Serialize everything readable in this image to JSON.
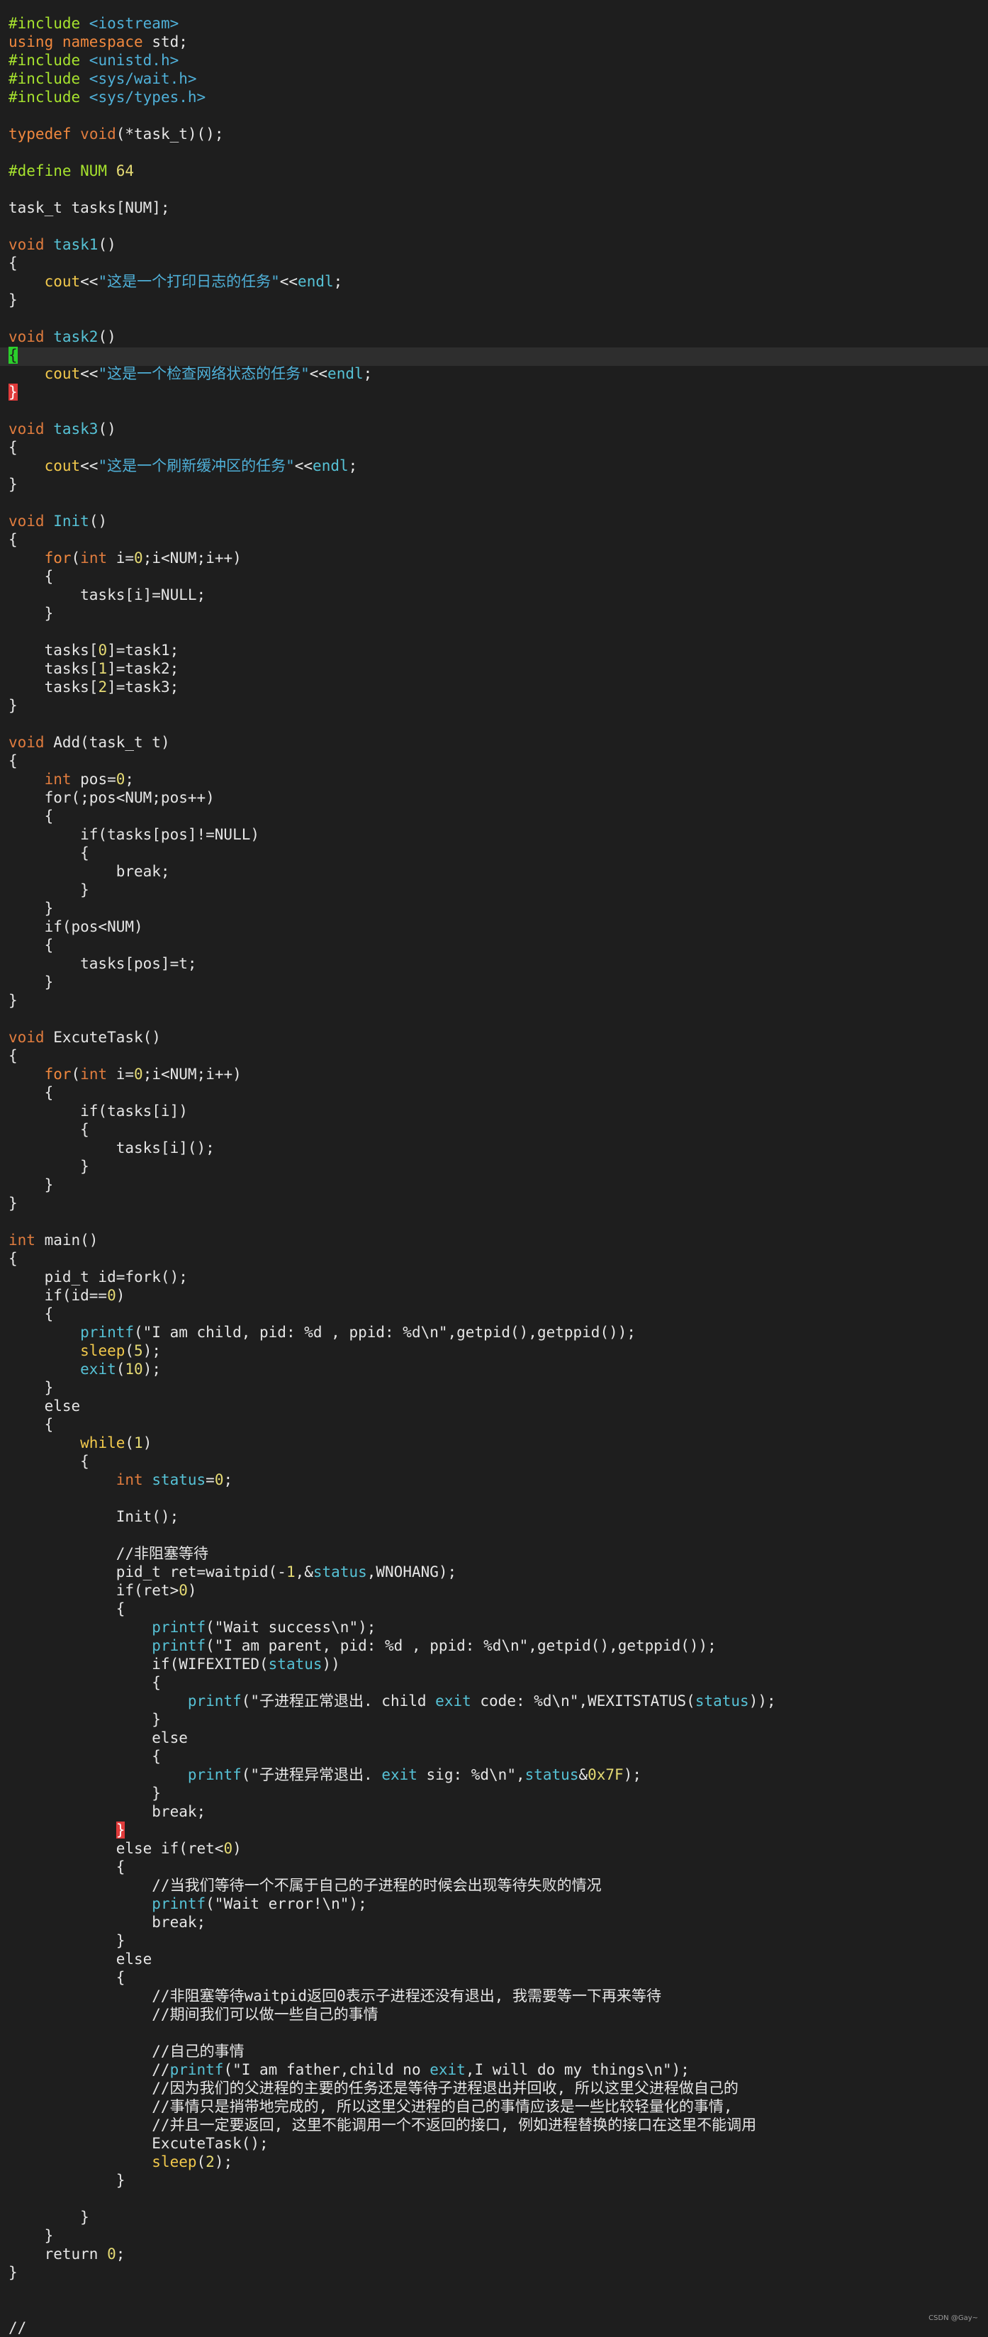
{
  "editor": {
    "watermark": "CSDN @Gay~",
    "lines": [
      [
        {
          "t": "#include ",
          "c": "pp"
        },
        {
          "t": "<iostream>",
          "c": "str"
        }
      ],
      [
        {
          "t": "using",
          "c": "kw"
        },
        {
          "t": " ",
          "c": "pl"
        },
        {
          "t": "namespace",
          "c": "kw"
        },
        {
          "t": " std;",
          "c": "pl"
        }
      ],
      [
        {
          "t": "#include ",
          "c": "pp"
        },
        {
          "t": "<unistd.h>",
          "c": "str"
        }
      ],
      [
        {
          "t": "#include ",
          "c": "pp"
        },
        {
          "t": "<sys/wait.h>",
          "c": "str"
        }
      ],
      [
        {
          "t": "#include ",
          "c": "pp"
        },
        {
          "t": "<sys/types.h>",
          "c": "str"
        }
      ],
      [],
      [
        {
          "t": "typedef",
          "c": "kw"
        },
        {
          "t": " ",
          "c": "pl"
        },
        {
          "t": "void",
          "c": "ty"
        },
        {
          "t": "(*task_t)();",
          "c": "pl"
        }
      ],
      [],
      [
        {
          "t": "#define NUM ",
          "c": "pp"
        },
        {
          "t": "64",
          "c": "num"
        }
      ],
      [],
      [
        {
          "t": "task_t tasks[NUM];",
          "c": "pl"
        }
      ],
      [],
      [
        {
          "t": "void",
          "c": "ty"
        },
        {
          "t": " ",
          "c": "pl"
        },
        {
          "t": "task1",
          "c": "ent"
        },
        {
          "t": "()",
          "c": "pl"
        }
      ],
      [
        {
          "t": "{",
          "c": "pl"
        }
      ],
      [
        {
          "t": "    ",
          "c": "pl"
        },
        {
          "t": "cout",
          "c": "fn"
        },
        {
          "t": "<<",
          "c": "pl"
        },
        {
          "t": "\"这是一个打印日志的任务\"",
          "c": "str"
        },
        {
          "t": "<<",
          "c": "pl"
        },
        {
          "t": "endl",
          "c": "ent"
        },
        {
          "t": ";",
          "c": "pl"
        }
      ],
      [
        {
          "t": "}",
          "c": "pl"
        }
      ],
      [],
      [
        {
          "t": "void",
          "c": "ty"
        },
        {
          "t": " ",
          "c": "pl"
        },
        {
          "t": "task2",
          "c": "ent"
        },
        {
          "t": "()",
          "c": "pl"
        }
      ],
      [
        {
          "t": "{",
          "c": "cur-green"
        }
      ],
      [
        {
          "t": "    ",
          "c": "pl"
        },
        {
          "t": "cout",
          "c": "fn"
        },
        {
          "t": "<<",
          "c": "pl"
        },
        {
          "t": "\"这是一个检查网络状态的任务\"",
          "c": "str"
        },
        {
          "t": "<<",
          "c": "pl"
        },
        {
          "t": "endl",
          "c": "ent"
        },
        {
          "t": ";",
          "c": "pl"
        }
      ],
      [
        {
          "t": "}",
          "c": "cur-red"
        }
      ],
      [],
      [
        {
          "t": "void",
          "c": "ty"
        },
        {
          "t": " ",
          "c": "pl"
        },
        {
          "t": "task3",
          "c": "ent"
        },
        {
          "t": "()",
          "c": "pl"
        }
      ],
      [
        {
          "t": "{",
          "c": "pl"
        }
      ],
      [
        {
          "t": "    ",
          "c": "pl"
        },
        {
          "t": "cout",
          "c": "fn"
        },
        {
          "t": "<<",
          "c": "pl"
        },
        {
          "t": "\"这是一个刷新缓冲区的任务\"",
          "c": "str"
        },
        {
          "t": "<<",
          "c": "pl"
        },
        {
          "t": "endl",
          "c": "ent"
        },
        {
          "t": ";",
          "c": "pl"
        }
      ],
      [
        {
          "t": "}",
          "c": "pl"
        }
      ],
      [],
      [
        {
          "t": "void",
          "c": "ty"
        },
        {
          "t": " ",
          "c": "pl"
        },
        {
          "t": "Init",
          "c": "ent"
        },
        {
          "t": "()",
          "c": "pl"
        }
      ],
      [
        {
          "t": "{",
          "c": "pl"
        }
      ],
      [
        {
          "t": "    ",
          "c": "pl"
        },
        {
          "t": "for",
          "c": "kw"
        },
        {
          "t": "(",
          "c": "pl"
        },
        {
          "t": "int",
          "c": "ty"
        },
        {
          "t": " i=",
          "c": "pl"
        },
        {
          "t": "0",
          "c": "num"
        },
        {
          "t": ";i<NUM;i++)",
          "c": "pl"
        }
      ],
      [
        {
          "t": "    {",
          "c": "pl"
        }
      ],
      [
        {
          "t": "        tasks[i]=NULL;",
          "c": "pl"
        }
      ],
      [
        {
          "t": "    }",
          "c": "pl"
        }
      ],
      [],
      [
        {
          "t": "    tasks[",
          "c": "pl"
        },
        {
          "t": "0",
          "c": "num"
        },
        {
          "t": "]=task1;",
          "c": "pl"
        }
      ],
      [
        {
          "t": "    tasks[",
          "c": "pl"
        },
        {
          "t": "1",
          "c": "num"
        },
        {
          "t": "]=task2;",
          "c": "pl"
        }
      ],
      [
        {
          "t": "    tasks[",
          "c": "pl"
        },
        {
          "t": "2",
          "c": "num"
        },
        {
          "t": "]=task3;",
          "c": "pl"
        }
      ],
      [
        {
          "t": "}",
          "c": "pl"
        }
      ],
      [],
      [
        {
          "t": "void",
          "c": "ty"
        },
        {
          "t": " Add(task_t t)",
          "c": "pl"
        }
      ],
      [
        {
          "t": "{",
          "c": "pl"
        }
      ],
      [
        {
          "t": "    ",
          "c": "pl"
        },
        {
          "t": "int",
          "c": "ty"
        },
        {
          "t": " pos=",
          "c": "pl"
        },
        {
          "t": "0",
          "c": "num"
        },
        {
          "t": ";",
          "c": "pl"
        }
      ],
      [
        {
          "t": "    for(;pos<NUM;pos++)",
          "c": "pl"
        }
      ],
      [
        {
          "t": "    {",
          "c": "pl"
        }
      ],
      [
        {
          "t": "        if(tasks[pos]!=NULL)",
          "c": "pl"
        }
      ],
      [
        {
          "t": "        {",
          "c": "pl"
        }
      ],
      [
        {
          "t": "            break;",
          "c": "pl"
        }
      ],
      [
        {
          "t": "        }",
          "c": "pl"
        }
      ],
      [
        {
          "t": "    }",
          "c": "pl"
        }
      ],
      [
        {
          "t": "    if(pos<NUM)",
          "c": "pl"
        }
      ],
      [
        {
          "t": "    {",
          "c": "pl"
        }
      ],
      [
        {
          "t": "        tasks[pos]=t;",
          "c": "pl"
        }
      ],
      [
        {
          "t": "    }",
          "c": "pl"
        }
      ],
      [
        {
          "t": "}",
          "c": "pl"
        }
      ],
      [],
      [
        {
          "t": "void",
          "c": "ty"
        },
        {
          "t": " ExcuteTask()",
          "c": "pl"
        }
      ],
      [
        {
          "t": "{",
          "c": "pl"
        }
      ],
      [
        {
          "t": "    ",
          "c": "pl"
        },
        {
          "t": "for",
          "c": "kw"
        },
        {
          "t": "(",
          "c": "pl"
        },
        {
          "t": "int",
          "c": "ty"
        },
        {
          "t": " i=",
          "c": "pl"
        },
        {
          "t": "0",
          "c": "num"
        },
        {
          "t": ";i<NUM;i++)",
          "c": "pl"
        }
      ],
      [
        {
          "t": "    {",
          "c": "pl"
        }
      ],
      [
        {
          "t": "        if(tasks[i])",
          "c": "pl"
        }
      ],
      [
        {
          "t": "        {",
          "c": "pl"
        }
      ],
      [
        {
          "t": "            tasks[i]();",
          "c": "pl"
        }
      ],
      [
        {
          "t": "        }",
          "c": "pl"
        }
      ],
      [
        {
          "t": "    }",
          "c": "pl"
        }
      ],
      [
        {
          "t": "}",
          "c": "pl"
        }
      ],
      [],
      [
        {
          "t": "int",
          "c": "ty"
        },
        {
          "t": " main()",
          "c": "pl"
        }
      ],
      [
        {
          "t": "{",
          "c": "pl"
        }
      ],
      [
        {
          "t": "    pid_t id=fork();",
          "c": "pl"
        }
      ],
      [
        {
          "t": "    if(id==",
          "c": "pl"
        },
        {
          "t": "0",
          "c": "num"
        },
        {
          "t": ")",
          "c": "pl"
        }
      ],
      [
        {
          "t": "    {",
          "c": "pl"
        }
      ],
      [
        {
          "t": "        ",
          "c": "pl"
        },
        {
          "t": "printf",
          "c": "ent"
        },
        {
          "t": "(\"I am child, pid: %d , ppid: %d\\n\",getpid(),getppid());",
          "c": "pl"
        }
      ],
      [
        {
          "t": "        ",
          "c": "pl"
        },
        {
          "t": "sleep",
          "c": "fn"
        },
        {
          "t": "(",
          "c": "pl"
        },
        {
          "t": "5",
          "c": "num"
        },
        {
          "t": ");",
          "c": "pl"
        }
      ],
      [
        {
          "t": "        ",
          "c": "pl"
        },
        {
          "t": "exit",
          "c": "ent"
        },
        {
          "t": "(",
          "c": "pl"
        },
        {
          "t": "10",
          "c": "num"
        },
        {
          "t": ");",
          "c": "pl"
        }
      ],
      [
        {
          "t": "    }",
          "c": "pl"
        }
      ],
      [
        {
          "t": "    else",
          "c": "pl"
        }
      ],
      [
        {
          "t": "    {",
          "c": "pl"
        }
      ],
      [
        {
          "t": "        ",
          "c": "pl"
        },
        {
          "t": "while",
          "c": "fn"
        },
        {
          "t": "(",
          "c": "pl"
        },
        {
          "t": "1",
          "c": "num"
        },
        {
          "t": ")",
          "c": "pl"
        }
      ],
      [
        {
          "t": "        {",
          "c": "pl"
        }
      ],
      [
        {
          "t": "            ",
          "c": "pl"
        },
        {
          "t": "int",
          "c": "ty"
        },
        {
          "t": " ",
          "c": "pl"
        },
        {
          "t": "status",
          "c": "ent"
        },
        {
          "t": "=",
          "c": "pl"
        },
        {
          "t": "0",
          "c": "num"
        },
        {
          "t": ";",
          "c": "pl"
        }
      ],
      [],
      [
        {
          "t": "            Init();",
          "c": "pl"
        }
      ],
      [],
      [
        {
          "t": "            //非阻塞等待",
          "c": "cm"
        }
      ],
      [
        {
          "t": "            pid_t ret=waitpid(-",
          "c": "pl"
        },
        {
          "t": "1",
          "c": "num"
        },
        {
          "t": ",&",
          "c": "pl"
        },
        {
          "t": "status",
          "c": "ent"
        },
        {
          "t": ",WNOHANG);",
          "c": "pl"
        }
      ],
      [
        {
          "t": "            if(ret>",
          "c": "pl"
        },
        {
          "t": "0",
          "c": "num"
        },
        {
          "t": ")",
          "c": "pl"
        }
      ],
      [
        {
          "t": "            {",
          "c": "pl"
        }
      ],
      [
        {
          "t": "                ",
          "c": "pl"
        },
        {
          "t": "printf",
          "c": "ent"
        },
        {
          "t": "(\"Wait success\\n\");",
          "c": "pl"
        }
      ],
      [
        {
          "t": "                ",
          "c": "pl"
        },
        {
          "t": "printf",
          "c": "ent"
        },
        {
          "t": "(\"I am parent, pid: %d , ppid: %d\\n\",getpid(),getppid());",
          "c": "pl"
        }
      ],
      [
        {
          "t": "                if(WIFEXITED(",
          "c": "pl"
        },
        {
          "t": "status",
          "c": "ent"
        },
        {
          "t": "))",
          "c": "pl"
        }
      ],
      [
        {
          "t": "                {",
          "c": "pl"
        }
      ],
      [
        {
          "t": "                    ",
          "c": "pl"
        },
        {
          "t": "printf",
          "c": "ent"
        },
        {
          "t": "(\"子进程正常退出. child ",
          "c": "pl"
        },
        {
          "t": "exit",
          "c": "ent"
        },
        {
          "t": " code: %d\\n\",WEXITSTATUS(",
          "c": "pl"
        },
        {
          "t": "status",
          "c": "ent"
        },
        {
          "t": "));",
          "c": "pl"
        }
      ],
      [
        {
          "t": "                }",
          "c": "pl"
        }
      ],
      [
        {
          "t": "                else",
          "c": "pl"
        }
      ],
      [
        {
          "t": "                {",
          "c": "pl"
        }
      ],
      [
        {
          "t": "                    ",
          "c": "pl"
        },
        {
          "t": "printf",
          "c": "ent"
        },
        {
          "t": "(\"子进程异常退出. ",
          "c": "pl"
        },
        {
          "t": "exit",
          "c": "ent"
        },
        {
          "t": " sig: %d\\n\",",
          "c": "pl"
        },
        {
          "t": "status",
          "c": "ent"
        },
        {
          "t": "&",
          "c": "pl"
        },
        {
          "t": "0x7F",
          "c": "num"
        },
        {
          "t": ");",
          "c": "pl"
        }
      ],
      [
        {
          "t": "                }",
          "c": "pl"
        }
      ],
      [
        {
          "t": "                break;",
          "c": "pl"
        }
      ],
      [
        {
          "t": "            ",
          "c": "pl"
        },
        {
          "t": "}",
          "c": "cur-red"
        }
      ],
      [
        {
          "t": "            else if(ret<",
          "c": "pl"
        },
        {
          "t": "0",
          "c": "num"
        },
        {
          "t": ")",
          "c": "pl"
        }
      ],
      [
        {
          "t": "            {",
          "c": "pl"
        }
      ],
      [
        {
          "t": "                //当我们等待一个不属于自己的子进程的时候会出现等待失败的情况",
          "c": "cm"
        }
      ],
      [
        {
          "t": "                ",
          "c": "pl"
        },
        {
          "t": "printf",
          "c": "ent"
        },
        {
          "t": "(\"Wait error!\\n\");",
          "c": "pl"
        }
      ],
      [
        {
          "t": "                break;",
          "c": "pl"
        }
      ],
      [
        {
          "t": "            }",
          "c": "pl"
        }
      ],
      [
        {
          "t": "            else",
          "c": "pl"
        }
      ],
      [
        {
          "t": "            {",
          "c": "pl"
        }
      ],
      [
        {
          "t": "                //非阻塞等待waitpid返回0表示子进程还没有退出, 我需要等一下再来等待",
          "c": "cm"
        }
      ],
      [
        {
          "t": "                //期间我们可以做一些自己的事情",
          "c": "cm"
        }
      ],
      [],
      [
        {
          "t": "                //自己的事情",
          "c": "cm"
        }
      ],
      [
        {
          "t": "                //",
          "c": "cm"
        },
        {
          "t": "printf",
          "c": "ent"
        },
        {
          "t": "(\"I am father,child no ",
          "c": "cm"
        },
        {
          "t": "exit",
          "c": "ent"
        },
        {
          "t": ",I will do my things\\n\");",
          "c": "cm"
        }
      ],
      [
        {
          "t": "                //因为我们的父进程的主要的任务还是等待子进程退出并回收, 所以这里父进程做自己的",
          "c": "cm"
        }
      ],
      [
        {
          "t": "                //事情只是捎带地完成的, 所以这里父进程的自己的事情应该是一些比较轻量化的事情,",
          "c": "cm"
        }
      ],
      [
        {
          "t": "                //并且一定要返回, 这里不能调用一个不返回的接口, 例如进程替换的接口在这里不能调用",
          "c": "cm"
        }
      ],
      [
        {
          "t": "                ExcuteTask();",
          "c": "pl"
        }
      ],
      [
        {
          "t": "                ",
          "c": "pl"
        },
        {
          "t": "sleep",
          "c": "fn"
        },
        {
          "t": "(",
          "c": "pl"
        },
        {
          "t": "2",
          "c": "num"
        },
        {
          "t": ");",
          "c": "pl"
        }
      ],
      [
        {
          "t": "            }",
          "c": "pl"
        }
      ],
      [],
      [
        {
          "t": "        }",
          "c": "pl"
        }
      ],
      [
        {
          "t": "    }",
          "c": "pl"
        }
      ],
      [
        {
          "t": "    return ",
          "c": "pl"
        },
        {
          "t": "0",
          "c": "num"
        },
        {
          "t": ";",
          "c": "pl"
        }
      ],
      [
        {
          "t": "}",
          "c": "pl"
        }
      ],
      [],
      [],
      [
        {
          "t": "//",
          "c": "cm"
        }
      ]
    ]
  }
}
